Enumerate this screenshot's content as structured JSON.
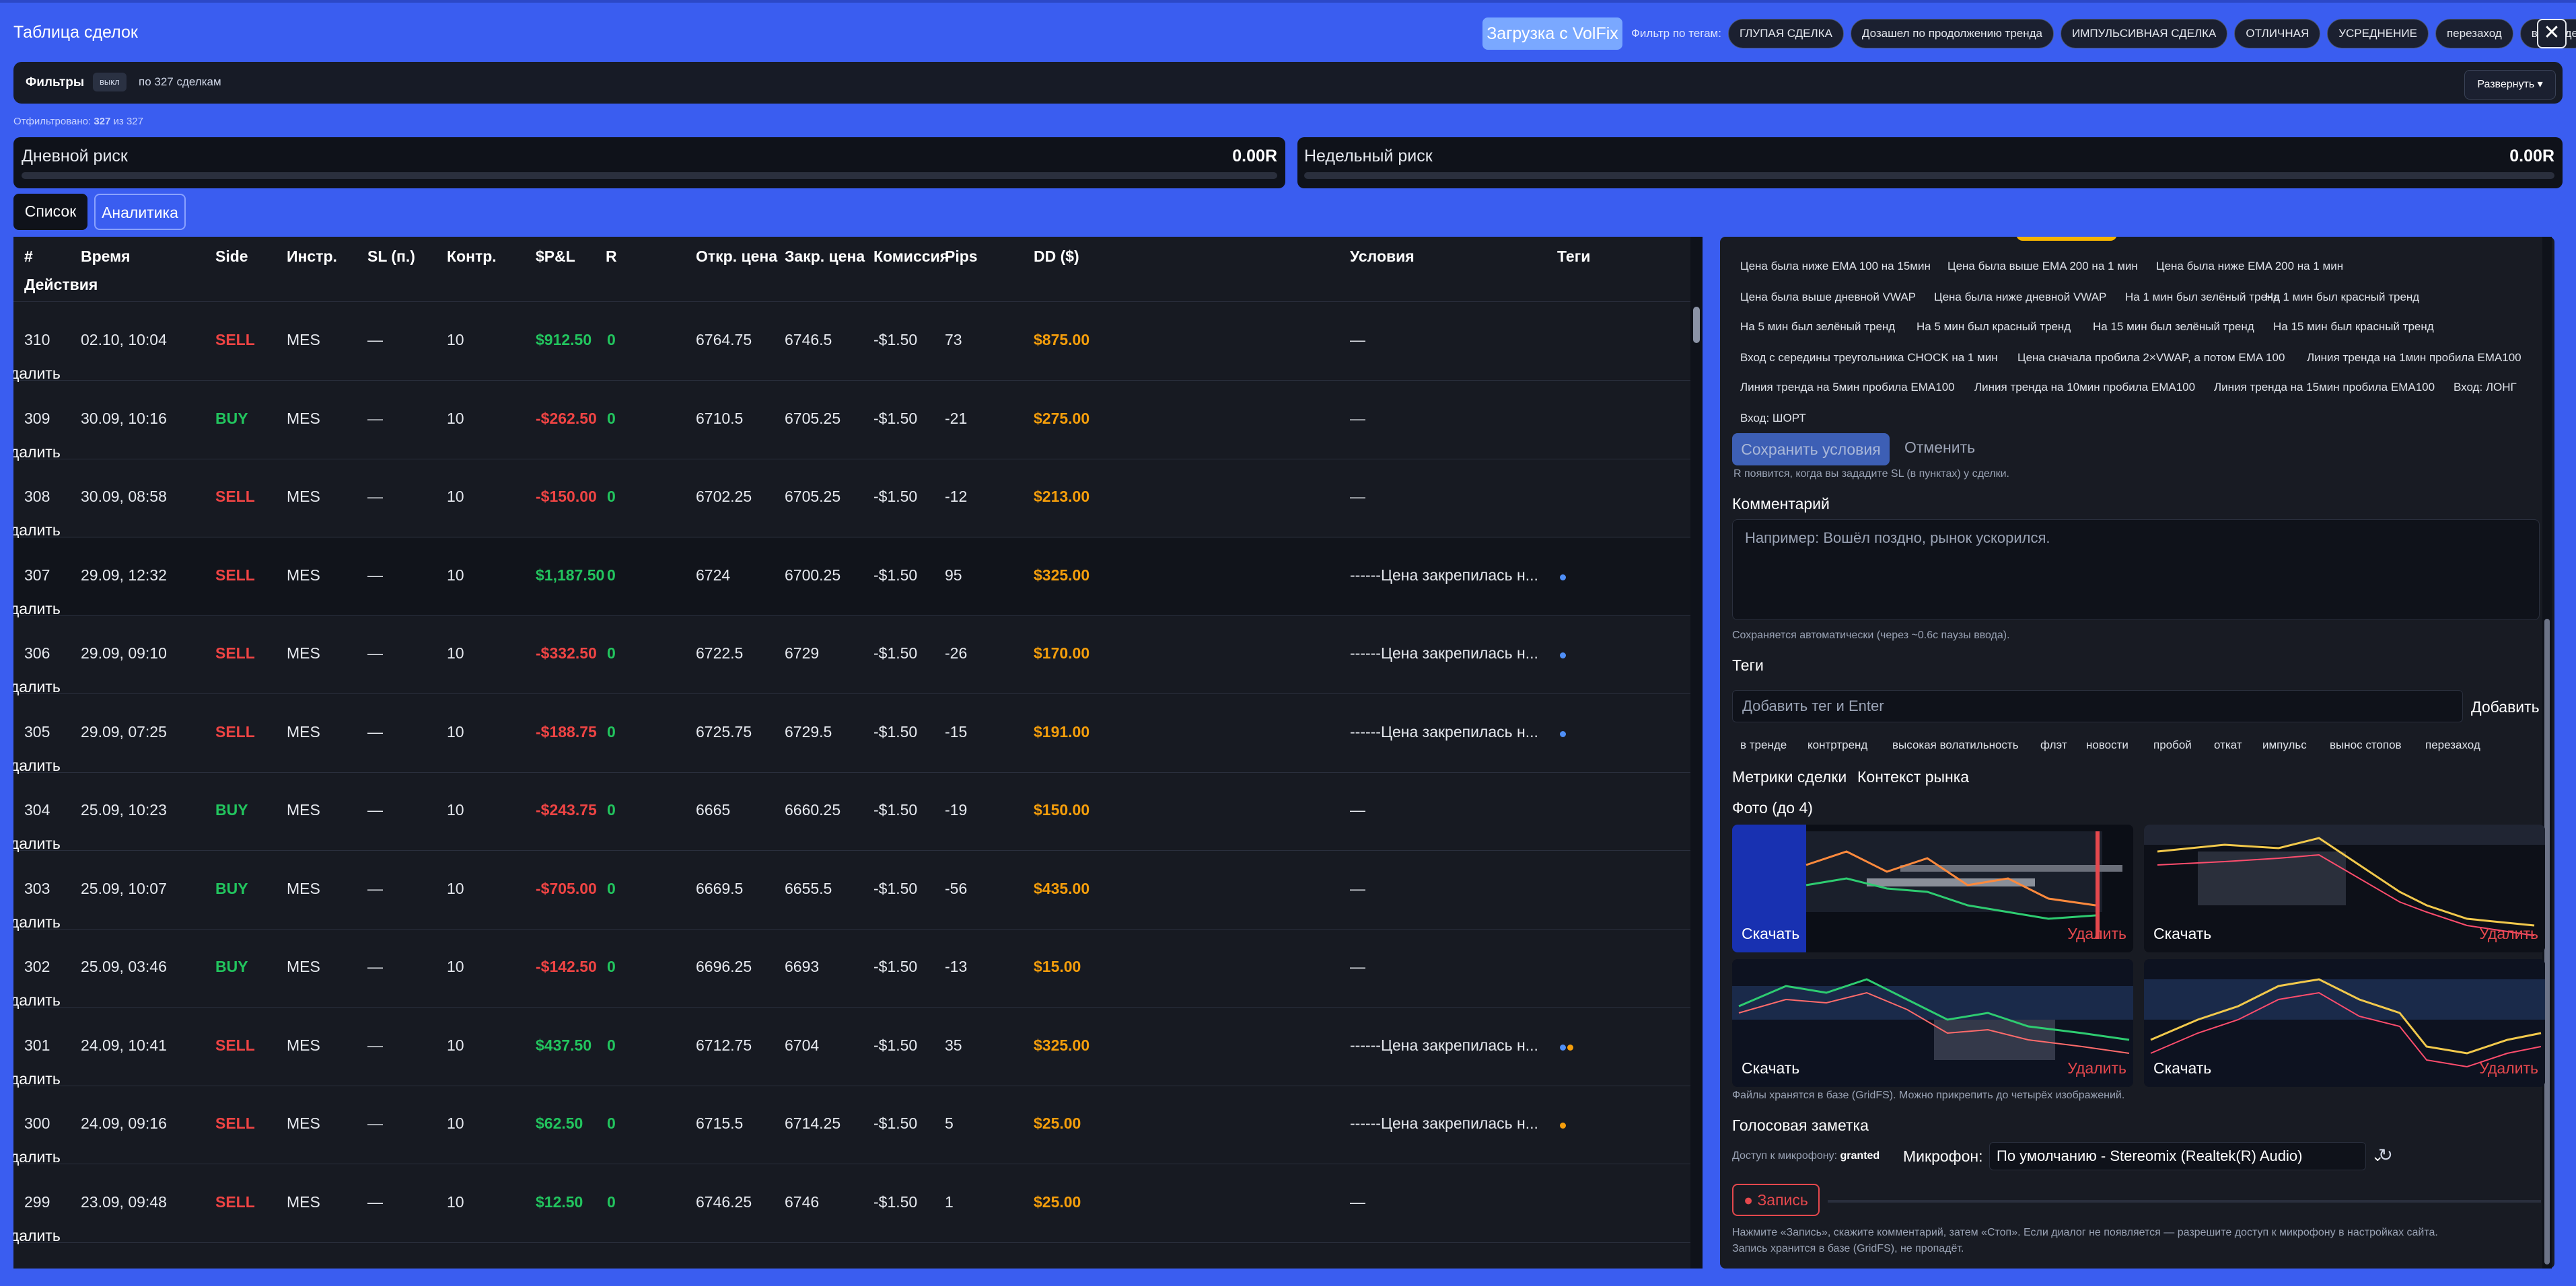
{
  "header": {
    "title": "Таблица сделок",
    "import_button": "Загрузка с VolFix",
    "tag_filter_label": "Фильтр по тегам:",
    "tag_filters": [
      "ГЛУПАЯ СДЕЛКА",
      "Дозашел по продолжению тренда",
      "ИМПУЛЬСИВНАЯ СДЕЛКА",
      "ОТЛИЧНАЯ",
      "УСРЕДНЕНИЕ",
      "перезаход",
      "в тренде"
    ],
    "close": "✕"
  },
  "filters": {
    "title": "Фильтры",
    "badge": "выкл",
    "count_text": "по 327 сделкам",
    "expand_button": "Развернуть ▾",
    "filtered_prefix": "Отфильтровано:",
    "filtered_value": "327",
    "filtered_of": "из 327"
  },
  "risk": {
    "daily_label": "Дневной риск",
    "daily_value": "0.00R",
    "weekly_label": "Недельный риск",
    "weekly_value": "0.00R"
  },
  "view_tabs": {
    "list": "Список",
    "analytics": "Аналитика"
  },
  "table": {
    "headers": {
      "num": "#",
      "time": "Время",
      "side": "Side",
      "instr": "Инстр.",
      "sl": "SL (п.)",
      "contracts": "Контр.",
      "pnl": "$P&L",
      "r": "R",
      "open": "Откр. цена",
      "close": "Закр. цена",
      "commission": "Комиссия",
      "pips": "Pips",
      "dd": "DD ($)",
      "conditions": "Условия",
      "tags": "Теги",
      "actions": "Действия"
    },
    "delete_label": "Удалить",
    "rows": [
      {
        "num": "310",
        "time": "02.10, 10:04",
        "side": "SELL",
        "instr": "MES",
        "sl": "—",
        "contracts": "10",
        "pnl": "$912.50",
        "r": "0",
        "open": "6764.75",
        "close": "6746.5",
        "commission": "-$1.50",
        "pips": "73",
        "dd": "$875.00",
        "conditions": "—",
        "dots": []
      },
      {
        "num": "309",
        "time": "30.09, 10:16",
        "side": "BUY",
        "instr": "MES",
        "sl": "—",
        "contracts": "10",
        "pnl": "-$262.50",
        "r": "0",
        "open": "6710.5",
        "close": "6705.25",
        "commission": "-$1.50",
        "pips": "-21",
        "dd": "$275.00",
        "conditions": "—",
        "dots": []
      },
      {
        "num": "308",
        "time": "30.09, 08:58",
        "side": "SELL",
        "instr": "MES",
        "sl": "—",
        "contracts": "10",
        "pnl": "-$150.00",
        "r": "0",
        "open": "6702.25",
        "close": "6705.25",
        "commission": "-$1.50",
        "pips": "-12",
        "dd": "$213.00",
        "conditions": "—",
        "dots": []
      },
      {
        "num": "307",
        "time": "29.09, 12:32",
        "side": "SELL",
        "instr": "MES",
        "sl": "—",
        "contracts": "10",
        "pnl": "$1,187.50",
        "r": "0",
        "open": "6724",
        "close": "6700.25",
        "commission": "-$1.50",
        "pips": "95",
        "dd": "$325.00",
        "conditions": "------Цена закрепилась н...",
        "dots": [
          "blue"
        ]
      },
      {
        "num": "306",
        "time": "29.09, 09:10",
        "side": "SELL",
        "instr": "MES",
        "sl": "—",
        "contracts": "10",
        "pnl": "-$332.50",
        "r": "0",
        "open": "6722.5",
        "close": "6729",
        "commission": "-$1.50",
        "pips": "-26",
        "dd": "$170.00",
        "conditions": "------Цена закрепилась н...",
        "dots": [
          "blue"
        ]
      },
      {
        "num": "305",
        "time": "29.09, 07:25",
        "side": "SELL",
        "instr": "MES",
        "sl": "—",
        "contracts": "10",
        "pnl": "-$188.75",
        "r": "0",
        "open": "6725.75",
        "close": "6729.5",
        "commission": "-$1.50",
        "pips": "-15",
        "dd": "$191.00",
        "conditions": "------Цена закрепилась н...",
        "dots": [
          "blue"
        ]
      },
      {
        "num": "304",
        "time": "25.09, 10:23",
        "side": "BUY",
        "instr": "MES",
        "sl": "—",
        "contracts": "10",
        "pnl": "-$243.75",
        "r": "0",
        "open": "6665",
        "close": "6660.25",
        "commission": "-$1.50",
        "pips": "-19",
        "dd": "$150.00",
        "conditions": "—",
        "dots": []
      },
      {
        "num": "303",
        "time": "25.09, 10:07",
        "side": "BUY",
        "instr": "MES",
        "sl": "—",
        "contracts": "10",
        "pnl": "-$705.00",
        "r": "0",
        "open": "6669.5",
        "close": "6655.5",
        "commission": "-$1.50",
        "pips": "-56",
        "dd": "$435.00",
        "conditions": "—",
        "dots": []
      },
      {
        "num": "302",
        "time": "25.09, 03:46",
        "side": "BUY",
        "instr": "MES",
        "sl": "—",
        "contracts": "10",
        "pnl": "-$142.50",
        "r": "0",
        "open": "6696.25",
        "close": "6693",
        "commission": "-$1.50",
        "pips": "-13",
        "dd": "$15.00",
        "conditions": "—",
        "dots": []
      },
      {
        "num": "301",
        "time": "24.09, 10:41",
        "side": "SELL",
        "instr": "MES",
        "sl": "—",
        "contracts": "10",
        "pnl": "$437.50",
        "r": "0",
        "open": "6712.75",
        "close": "6704",
        "commission": "-$1.50",
        "pips": "35",
        "dd": "$325.00",
        "conditions": "------Цена закрепилась н...",
        "dots": [
          "blue",
          "orange"
        ]
      },
      {
        "num": "300",
        "time": "24.09, 09:16",
        "side": "SELL",
        "instr": "MES",
        "sl": "—",
        "contracts": "10",
        "pnl": "$62.50",
        "r": "0",
        "open": "6715.5",
        "close": "6714.25",
        "commission": "-$1.50",
        "pips": "5",
        "dd": "$25.00",
        "conditions": "------Цена закрепилась н...",
        "dots": [
          "orange"
        ]
      },
      {
        "num": "299",
        "time": "23.09, 09:48",
        "side": "SELL",
        "instr": "MES",
        "sl": "—",
        "contracts": "10",
        "pnl": "$12.50",
        "r": "0",
        "open": "6746.25",
        "close": "6746",
        "commission": "-$1.50",
        "pips": "1",
        "dd": "$25.00",
        "conditions": "—",
        "dots": []
      }
    ]
  },
  "side_panel": {
    "conditions": [
      "Цена была ниже EMA 100 на 15мин",
      "Цена была выше EMA 200 на 1 мин",
      "Цена была ниже EMA 200 на 1 мин",
      "Цена была выше дневной VWAP",
      "Цена была ниже дневной VWAP",
      "На 1 мин был зелёный тренд",
      "На 1 мин был красный тренд",
      "На 5 мин был зелёный тренд",
      "На 5 мин был красный тренд",
      "На 15 мин был зелёный тренд",
      "На 15 мин был красный тренд",
      "Вход с середины треугольника CHOCK на 1 мин",
      "Цена сначала пробила 2×VWAP, а потом EMA 100",
      "Линия тренда на 1мин пробила EMA100",
      "Линия тренда на 5мин пробила EMA100",
      "Линия тренда на 10мин пробила EMA100",
      "Линия тренда на 15мин пробила EMA100",
      "Вход: ЛОНГ",
      "Вход: ШОРТ"
    ],
    "save_conditions": "Сохранить условия",
    "cancel": "Отменить",
    "r_hint": "R появится, когда вы зададите SL (в пунктах) у сделки.",
    "comment_title": "Комментарий",
    "comment_placeholder": "Например: Вошёл поздно, рынок ускорился.",
    "comment_hint": "Сохраняется автоматически (через ~0.6с паузы ввода).",
    "tags_title": "Теги",
    "tag_placeholder": "Добавить тег и Enter",
    "add_button": "Добавить",
    "tag_suggestions": [
      "в тренде",
      "контртренд",
      "высокая волатильность",
      "флэт",
      "новости",
      "пробой",
      "откат",
      "импульс",
      "вынос стопов",
      "перезаход"
    ],
    "metrics_link": "Метрики сделки",
    "context_link": "Контекст рынка",
    "photos_title": "Фото (до 4)",
    "download": "Скачать",
    "delete": "Удалить",
    "photos_hint": "Файлы хранятся в базе (GridFS). Можно прикрепить до четырёх изображений.",
    "voice_title": "Голосовая заметка",
    "mic_access_label": "Доступ к микрофону:",
    "mic_access_value": "granted",
    "mic_label": "Микрофон:",
    "mic_value": "По умолчанию - Stereomix (Realtek(R) Audio)",
    "record_button": "● Запись",
    "record_hint_1": "Нажмите «Запись», скажите комментарий, затем «Стоп». Если диалог не появляется — разрешите доступ к микрофону в настройках сайта.",
    "record_hint_2": "Запись хранится в базе (GridFS), не пропадёт."
  },
  "colors": {
    "accent": "#3a5df0",
    "buy": "#22c55e",
    "sell": "#ef4444",
    "profit": "#22c55e",
    "loss": "#ef4444",
    "dd": "#f59e0b",
    "tag_blue": "#4f8ff7",
    "tag_orange": "#f59e0b"
  }
}
